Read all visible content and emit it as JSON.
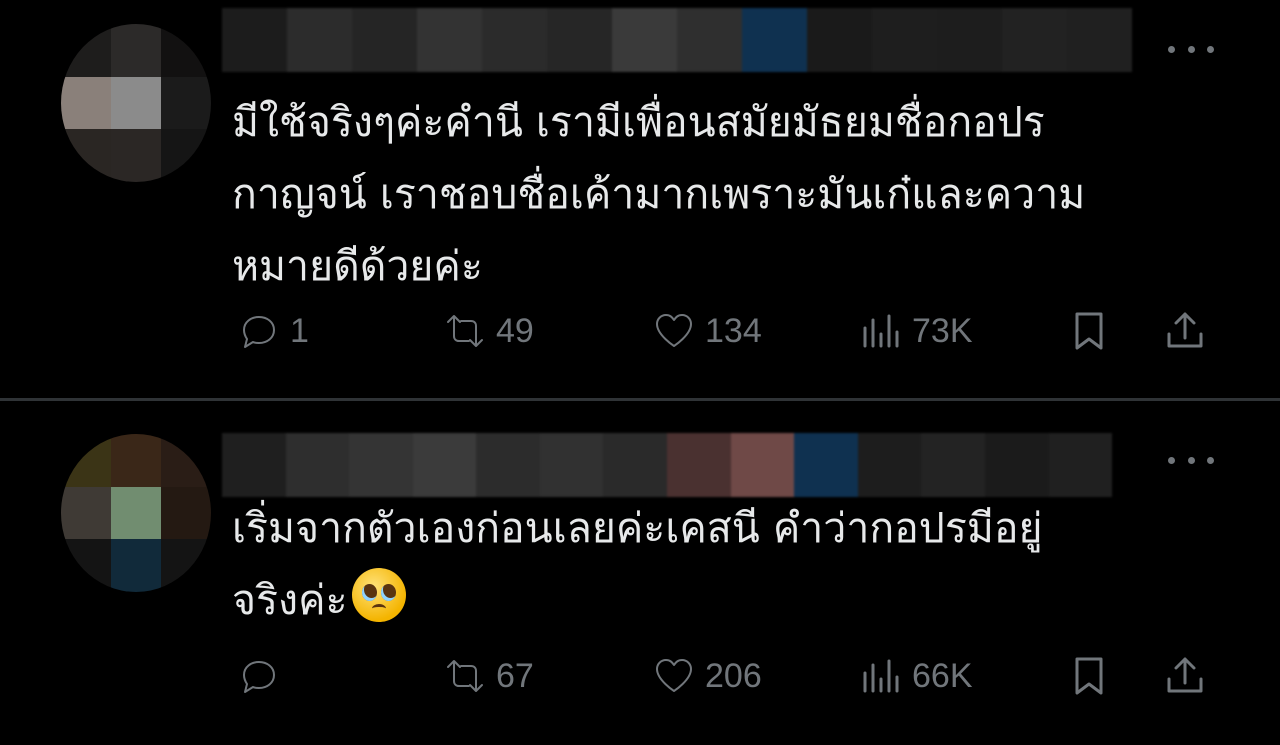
{
  "posts": [
    {
      "text": "มีใช้จริงๆค่ะคำนี เรามีเพื่อนสมัยมัธยมชื่อกอปร\nกาญจน์ เราชอบชื่อเค้ามากเพราะมันเก๋และความ\nหมายดีด้วยค่ะ",
      "avatar_colors": [
        "#1e1d1c",
        "#2c2a29",
        "#121111",
        "#8a807a",
        "#8b8b8b",
        "#1b1b1b",
        "#2a2623",
        "#2b2725",
        "#151515"
      ],
      "name_colors": [
        "#1c1c1c",
        "#2c2c2c",
        "#252525",
        "#333333",
        "#2b2b2b",
        "#262626",
        "#3a3a3a",
        "#2f2f2f",
        "#0f3150",
        "#1a1a1a",
        "#1e1e1e",
        "#1d1d1d",
        "#222222",
        "#202020"
      ],
      "reply_count": "1",
      "repost_count": "49",
      "like_count": "134",
      "view_count": "73K"
    },
    {
      "text": "เริ่มจากตัวเองก่อนเลยค่ะเคสนี คำว่ากอปรมีอยู่\nจริงค่ะ",
      "emoji": "pleading-face",
      "avatar_colors": [
        "#3b3416",
        "#3a2718",
        "#2a1d16",
        "#3f3a35",
        "#718d70",
        "#241912",
        "#141414",
        "#112a3a",
        "#141414"
      ],
      "name_colors": [
        "#1f1f1f",
        "#2e2e2e",
        "#343434",
        "#3b3b3b",
        "#2c2c2c",
        "#313131",
        "#2a2a2a",
        "#4a3130",
        "#6f4947",
        "#0f3150",
        "#1d1d1d",
        "#232323",
        "#1b1b1b",
        "#202020"
      ],
      "reply_count": "",
      "repost_count": "67",
      "like_count": "206",
      "view_count": "66K"
    }
  ],
  "colors": {
    "background": "#000000",
    "text": "#e7e9ea",
    "muted": "#71767b",
    "divider": "#2f3336"
  }
}
